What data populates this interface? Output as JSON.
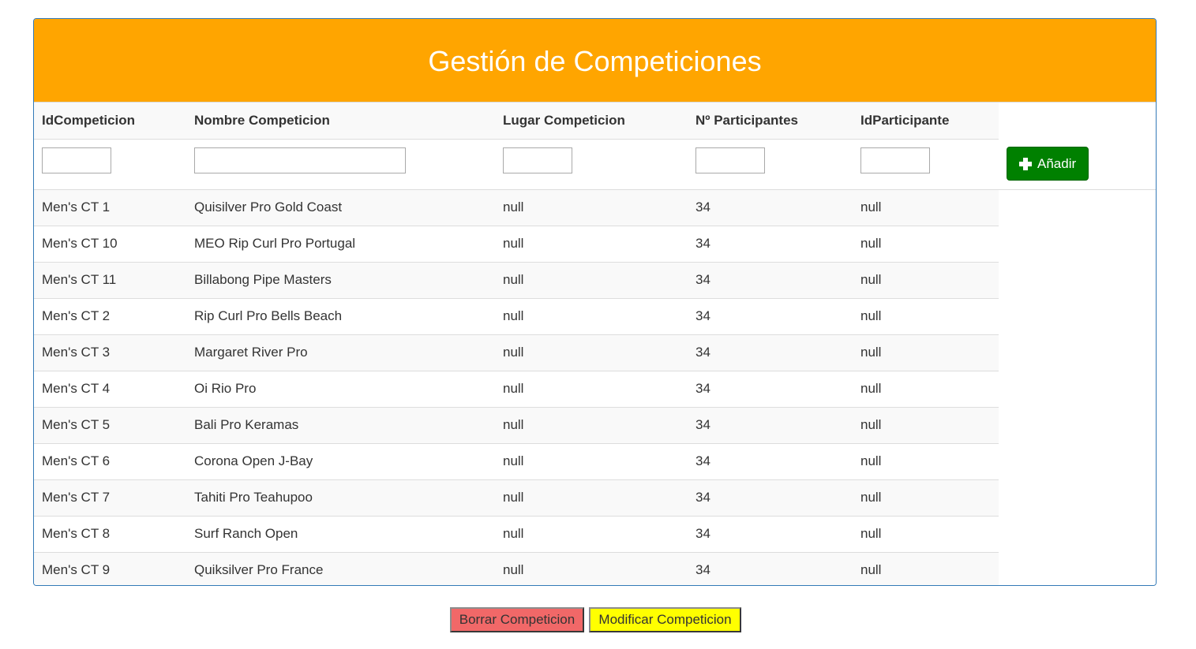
{
  "header": {
    "title": "Gestión de Competiciones"
  },
  "table": {
    "columns": [
      "IdCompeticion",
      "Nombre Competicion",
      "Lugar Competicion",
      "Nº Participantes",
      "IdParticipante"
    ],
    "add_button_label": "Añadir",
    "rows": [
      [
        "Men's CT 1",
        "Quisilver Pro Gold Coast",
        "null",
        "34",
        "null"
      ],
      [
        "Men's CT 10",
        "MEO Rip Curl Pro Portugal",
        "null",
        "34",
        "null"
      ],
      [
        "Men's CT 11",
        "Billabong Pipe Masters",
        "null",
        "34",
        "null"
      ],
      [
        "Men's CT 2",
        "Rip Curl Pro Bells Beach",
        "null",
        "34",
        "null"
      ],
      [
        "Men's CT 3",
        "Margaret River Pro",
        "null",
        "34",
        "null"
      ],
      [
        "Men's CT 4",
        "Oi Rio Pro",
        "null",
        "34",
        "null"
      ],
      [
        "Men's CT 5",
        "Bali Pro Keramas",
        "null",
        "34",
        "null"
      ],
      [
        "Men's CT 6",
        "Corona Open J-Bay",
        "null",
        "34",
        "null"
      ],
      [
        "Men's CT 7",
        "Tahiti Pro Teahupoo",
        "null",
        "34",
        "null"
      ],
      [
        "Men's CT 8",
        "Surf Ranch Open",
        "null",
        "34",
        "null"
      ],
      [
        "Men's CT 9",
        "Quiksilver Pro France",
        "null",
        "34",
        "null"
      ]
    ]
  },
  "footer": {
    "delete_label": "Borrar Competicion",
    "modify_label": "Modificar Competicion"
  },
  "colors": {
    "header_bg": "#ffa500",
    "add_button": "#008000",
    "delete_button": "#f16868",
    "modify_button": "#ffff00",
    "panel_border": "#337ab7"
  },
  "icons": {
    "add": "plus-icon"
  }
}
